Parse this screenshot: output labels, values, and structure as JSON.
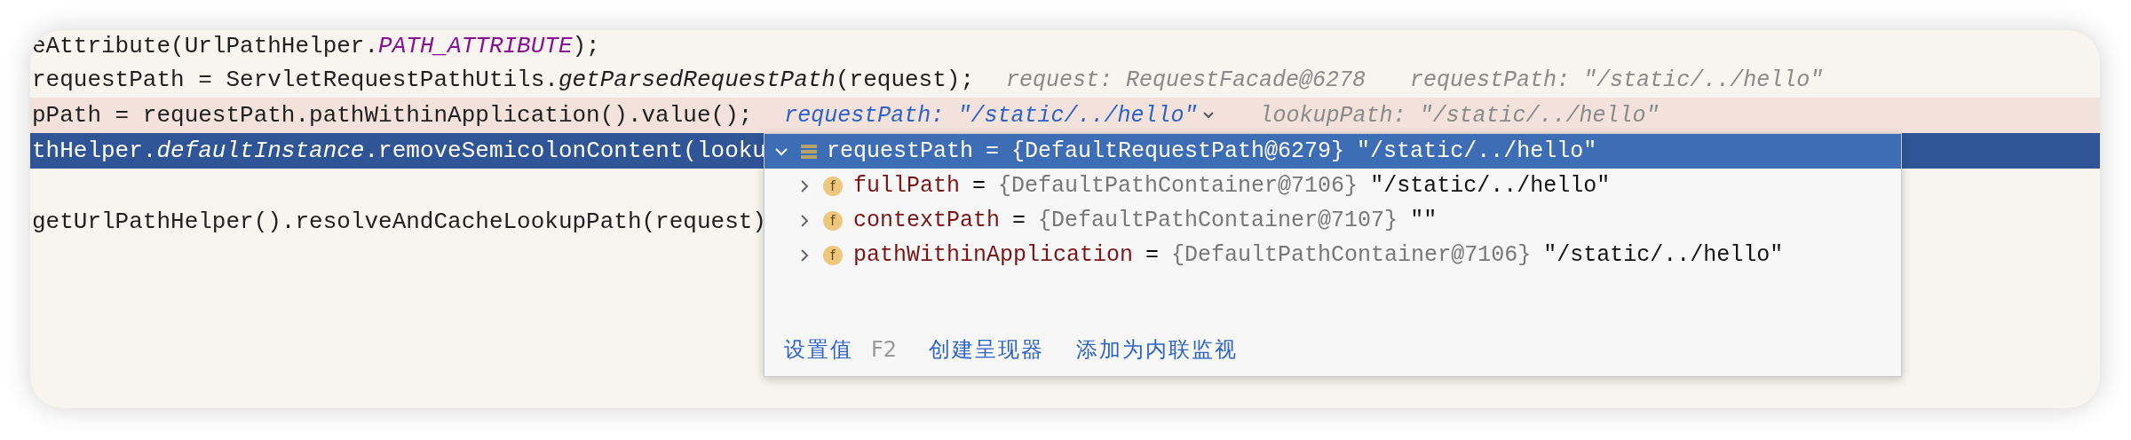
{
  "editor": {
    "lines": [
      {
        "execution_point": false,
        "selected": false,
        "segments": [
          {
            "text": "eAttribute(UrlPathHelper.",
            "kind": "plain"
          },
          {
            "text": "PATH_ATTRIBUTE",
            "kind": "constant"
          },
          {
            "text": ");",
            "kind": "plain"
          }
        ]
      },
      {
        "execution_point": false,
        "selected": false,
        "segments": [
          {
            "text": "requestPath = ServletRequestPathUtils.",
            "kind": "plain"
          },
          {
            "text": "getParsedRequestPath",
            "kind": "static"
          },
          {
            "text": "(request);",
            "kind": "plain"
          }
        ],
        "hints": [
          {
            "text": "request: RequestFacade@6278",
            "kind": "value",
            "expandable": false
          },
          {
            "text": "requestPath: \"/static/../hello\"",
            "kind": "value",
            "expandable": false
          }
        ]
      },
      {
        "execution_point": true,
        "selected": false,
        "segments": [
          {
            "text": "pPath = requestPath.pathWithinApplication().value();",
            "kind": "plain"
          }
        ],
        "hints": [
          {
            "text": "requestPath: \"/static/../hello\"",
            "kind": "link",
            "expandable": true
          },
          {
            "text": "lookupPath: \"/static/../hello\"",
            "kind": "value",
            "expandable": false
          }
        ]
      },
      {
        "execution_point": false,
        "selected": true,
        "segments": [
          {
            "text": "thHelper.",
            "kind": "plain"
          },
          {
            "text": "defaultInstance",
            "kind": "static"
          },
          {
            "text": ".removeSemicolonContent(looku",
            "kind": "plain"
          }
        ]
      },
      {
        "execution_point": false,
        "selected": false
      },
      {
        "execution_point": false,
        "selected": false,
        "segments": [
          {
            "text": "getUrlPathHelper().resolveAndCacheLookupPath(request)",
            "kind": "plain"
          }
        ]
      }
    ]
  },
  "popup": {
    "root": {
      "name": "requestPath",
      "operator": "=",
      "type": "{DefaultRequestPath@6279}",
      "value": "\"/static/../hello\"",
      "expanded": true,
      "selected": true
    },
    "children": [
      {
        "badge": "f",
        "name": "fullPath",
        "operator": "=",
        "type": "{DefaultPathContainer@7106}",
        "value": "\"/static/../hello\"",
        "expanded": false,
        "selected": false
      },
      {
        "badge": "f",
        "name": "contextPath",
        "operator": "=",
        "type": "{DefaultPathContainer@7107}",
        "value": "\"\"",
        "expanded": false,
        "selected": false
      },
      {
        "badge": "f",
        "name": "pathWithinApplication",
        "operator": "=",
        "type": "{DefaultPathContainer@7106}",
        "value": "\"/static/../hello\"",
        "expanded": false,
        "selected": false
      }
    ],
    "actions": [
      {
        "label": "设置值",
        "shortcut": "F2"
      },
      {
        "label": "创建呈现器"
      },
      {
        "label": "添加为内联监视"
      }
    ]
  }
}
